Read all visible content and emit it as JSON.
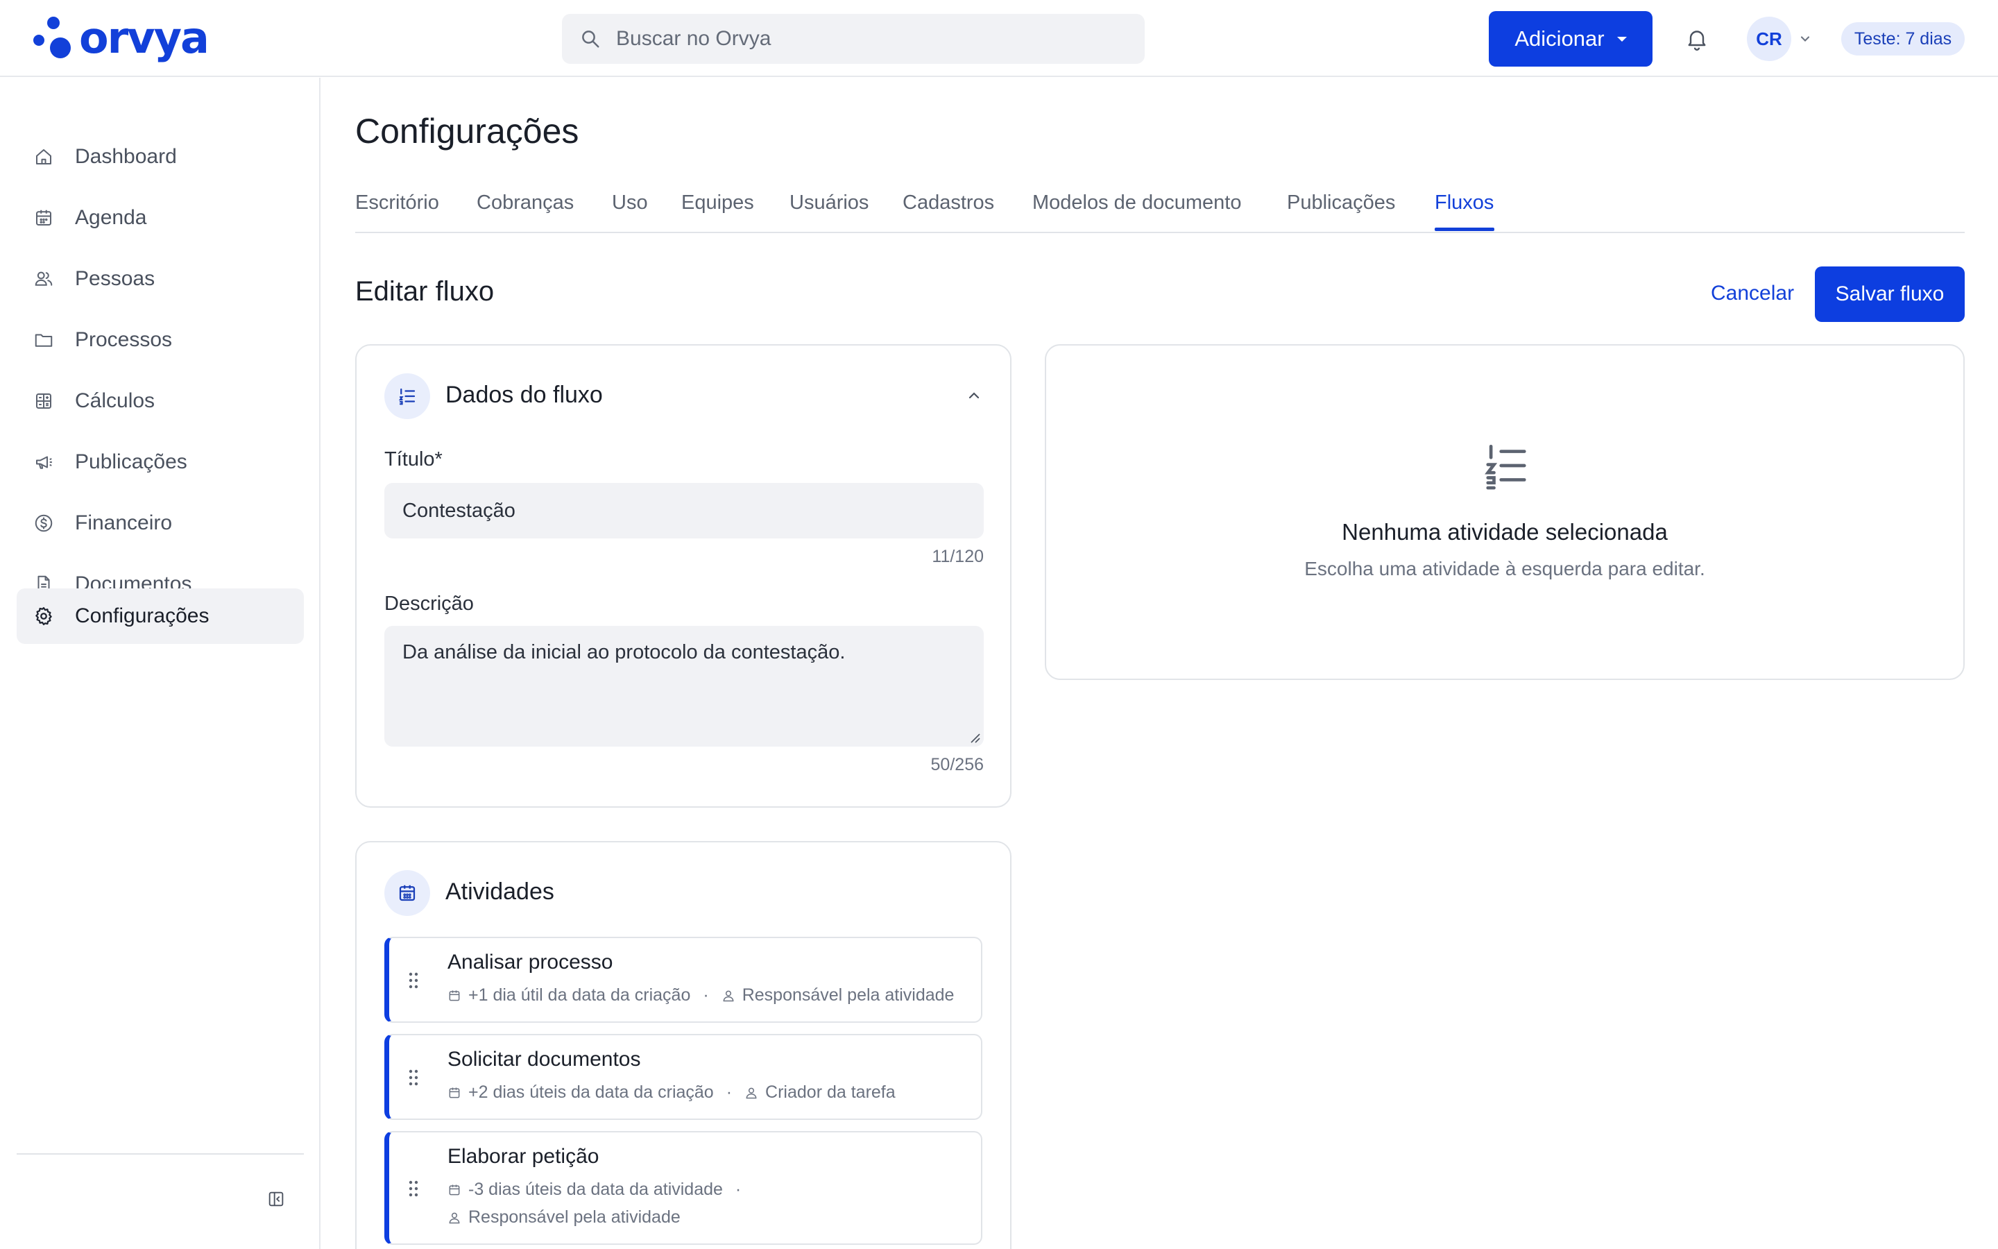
{
  "brand": {
    "name": "orvya",
    "color": "#1240d9"
  },
  "header": {
    "search_placeholder": "Buscar no Orvya",
    "add_label": "Adicionar",
    "avatar_initials": "CR",
    "trial_badge": "Teste: 7 dias"
  },
  "sidebar": {
    "items": [
      {
        "label": "Dashboard",
        "icon": "home-icon"
      },
      {
        "label": "Agenda",
        "icon": "calendar-icon"
      },
      {
        "label": "Pessoas",
        "icon": "people-icon"
      },
      {
        "label": "Processos",
        "icon": "folder-icon"
      },
      {
        "label": "Cálculos",
        "icon": "calculator-icon"
      },
      {
        "label": "Publicações",
        "icon": "megaphone-icon"
      },
      {
        "label": "Financeiro",
        "icon": "dollar-circle-icon"
      },
      {
        "label": "Documentos",
        "icon": "document-icon"
      },
      {
        "label": "Configurações",
        "icon": "gear-icon",
        "active": true
      }
    ]
  },
  "page": {
    "title": "Configurações",
    "tabs": [
      {
        "label": "Escritório"
      },
      {
        "label": "Cobranças"
      },
      {
        "label": "Uso"
      },
      {
        "label": "Equipes"
      },
      {
        "label": "Usuários"
      },
      {
        "label": "Cadastros"
      },
      {
        "label": "Modelos de documento"
      },
      {
        "label": "Publicações"
      },
      {
        "label": "Fluxos",
        "active": true
      }
    ],
    "section_title": "Editar fluxo",
    "cancel_label": "Cancelar",
    "save_label": "Salvar fluxo"
  },
  "flow_data": {
    "card_title": "Dados do fluxo",
    "title_label": "Título*",
    "title_value": "Contestação",
    "title_counter": "11/120",
    "description_label": "Descrição",
    "description_value": "Da análise da inicial ao protocolo da contestação.",
    "description_counter": "50/256"
  },
  "activities": {
    "card_title": "Atividades",
    "items": [
      {
        "title": "Analisar processo",
        "deadline": "+1 dia útil da data da criação",
        "assignee": "Responsável pela atividade"
      },
      {
        "title": "Solicitar documentos",
        "deadline": "+2 dias úteis da data da criação",
        "assignee": "Criador da tarefa"
      },
      {
        "title": "Elaborar petição",
        "deadline": "-3 dias úteis da data da atividade",
        "assignee": "Responsável pela atividade"
      }
    ],
    "separator": "·"
  },
  "empty_state": {
    "title": "Nenhuma atividade selecionada",
    "subtitle": "Escolha uma atividade à esquerda para editar."
  }
}
